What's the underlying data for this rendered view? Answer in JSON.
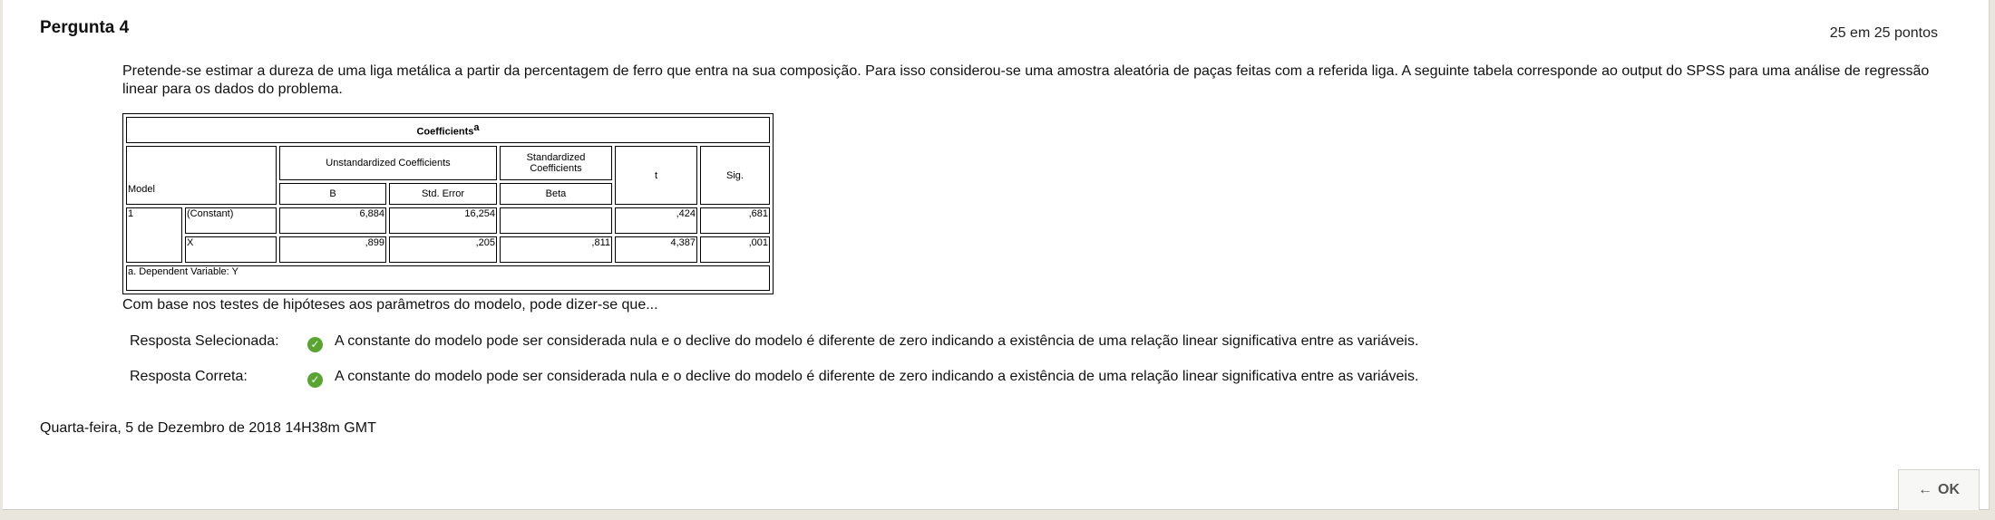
{
  "question": {
    "title": "Pergunta 4",
    "points": "25 em 25 pontos",
    "text": "Pretende-se estimar a dureza de uma liga metálica a partir da percentagem de ferro que entra na sua composição. Para isso considerou-se uma amostra aleatória de paças feitas com a referida liga. A seguinte tabela corresponde ao output do SPSS para uma análise de regressão linear para os dados do problema.",
    "after_table": "Com base nos testes de hipóteses aos parâmetros do modelo, pode dizer-se que..."
  },
  "table": {
    "title": "Coefficients",
    "title_sup": "a",
    "model_header": "Model",
    "unstd_header": "Unstandardized Coefficients",
    "std_header": "Standardized Coefficients",
    "t_header": "t",
    "sig_header": "Sig.",
    "b_header": "B",
    "se_header": "Std. Error",
    "beta_header": "Beta",
    "model_number": "1",
    "rows": [
      {
        "name": "(Constant)",
        "b": "6,884",
        "se": "16,254",
        "beta": "",
        "t": ",424",
        "sig": ",681"
      },
      {
        "name": "X",
        "b": ",899",
        "se": ",205",
        "beta": ",811",
        "t": "4,387",
        "sig": ",001"
      }
    ],
    "footnote": "a. Dependent Variable: Y"
  },
  "answers": {
    "selected_label": "Resposta Selecionada:",
    "selected_text": "A constante do modelo pode ser considerada nula e o declive do modelo é diferente de zero indicando a existência de uma relação linear significativa entre as variáveis.",
    "correct_label": "Resposta Correta:",
    "correct_text": "A constante do modelo pode ser considerada nula e o declive do modelo é diferente de zero indicando a existência de uma relação linear significativa entre as variáveis.",
    "check_icon": "check-circle-icon",
    "check_color": "#5aa531"
  },
  "footer": {
    "date": "Quarta-feira, 5 de Dezembro de 2018 14H38m GMT",
    "ok_label": "OK",
    "ok_arrow": "←"
  }
}
